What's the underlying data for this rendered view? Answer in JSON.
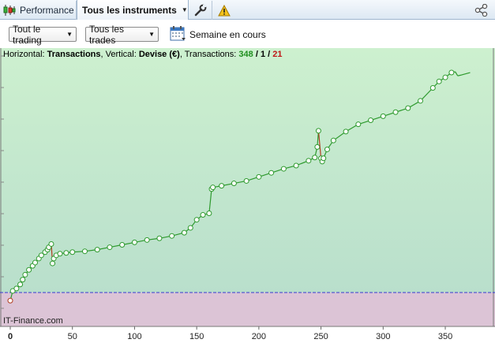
{
  "tabs": {
    "performance_label": "Performance",
    "instruments_label": "Tous les instruments"
  },
  "toolbar": {
    "trading_label": "Tout le trading",
    "trades_label": "Tous les trades",
    "period_label": "Semaine en cours"
  },
  "info": {
    "horizontal_prefix": "Horizontal:",
    "horizontal_value": "Transactions",
    "vertical_prefix": "Vertical:",
    "vertical_value": "Devise (€)",
    "count_prefix": "Transactions:",
    "total": "348",
    "separator": "/",
    "middle": "1",
    "losses": "21"
  },
  "watermark": "IT-Finance.com",
  "icons": {
    "performance": "candlestick-chart-icon",
    "wrench": "wrench-icon",
    "warning": "warning-triangle-icon",
    "share": "share-icon",
    "calendar": "calendar-icon"
  },
  "colors": {
    "profit_zone": "#c9eccc",
    "loss_zone": "#dcc4d6",
    "equity_line": "#2e9a2e",
    "drawdown_segment": "#b03a1e",
    "zero_line": "#3a3ad0"
  },
  "chart_data": {
    "type": "line",
    "title": "",
    "xlabel": "Transactions",
    "ylabel": "Devise (€)",
    "x_ticks": [
      0,
      50,
      100,
      150,
      200,
      250,
      300,
      350
    ],
    "xlim": [
      0,
      390
    ],
    "y_ticks": [],
    "grid": false,
    "zero_baseline": true,
    "series": [
      {
        "x": [
          0,
          2,
          5,
          8,
          10,
          12,
          15,
          18,
          20,
          23,
          25,
          28,
          30,
          31,
          33,
          34,
          35,
          37,
          40,
          45,
          50,
          60,
          70,
          80,
          90,
          100,
          110,
          120,
          130,
          140,
          145,
          150,
          155,
          160,
          162,
          163,
          170,
          180,
          190,
          200,
          210,
          220,
          230,
          240,
          245,
          247,
          248,
          250,
          251,
          252,
          255,
          260,
          270,
          280,
          290,
          300,
          310,
          320,
          330,
          340,
          345,
          350,
          355,
          358,
          360,
          363,
          370
        ],
        "y": [
          -10,
          2,
          5,
          10,
          16,
          22,
          28,
          33,
          37,
          42,
          46,
          50,
          53,
          56,
          60,
          36,
          42,
          46,
          48,
          49,
          50,
          51,
          53,
          56,
          59,
          62,
          65,
          67,
          70,
          74,
          80,
          90,
          96,
          98,
          128,
          130,
          132,
          135,
          138,
          143,
          148,
          153,
          157,
          163,
          167,
          180,
          200,
          166,
          162,
          166,
          177,
          188,
          199,
          208,
          213,
          218,
          223,
          228,
          237,
          253,
          261,
          266,
          272,
          273,
          268,
          269,
          272
        ],
        "color": "#2e9a2e"
      }
    ]
  }
}
